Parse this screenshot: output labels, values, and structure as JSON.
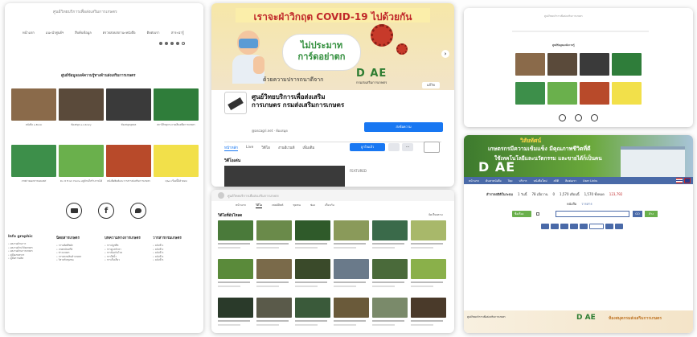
{
  "site": {
    "header_title": "ศูนย์วิทยบริการเพื่อส่งเสริมการเกษตร",
    "nav": [
      "หน้าแรก",
      "แนะนำศูนย์ฯ",
      "สืบค้นข้อมูล",
      "ตรวจสอบสถานะหนังสือ",
      "ติดต่อเรา",
      "สาระน่ารู้"
    ],
    "section_title": "ศูนย์ข้อมูลองค์ความรู้ทางด้านส่งเสริมการเกษตร",
    "tiles": [
      {
        "label": "หนังสือ e-Book",
        "color": "#8a6a4a"
      },
      {
        "label": "ห้องสมุด e-Library",
        "color": "#5a4a3a"
      },
      {
        "label": "ห้องสมุดบุคคล",
        "color": "#3a3a3a"
      },
      {
        "label": "สถานีวิทยุกระจายเสียงเพื่อการเกษตร",
        "color": "#2f7d3a"
      },
      {
        "label": "ภาพถ่ายเอกสารเผยแพร่",
        "color": "#3d8f4a"
      },
      {
        "label": "Do It From Home อยู่บ้านก็สร้างรายได้",
        "color": "#6ab04c"
      },
      {
        "label": "หนังสือพิมพ์และวารสารส่งเสริมการเกษตร",
        "color": "#b84a2a"
      },
      {
        "label": "Q&A เรื่องนี้มีคำตอบ",
        "color": "#f2e04a"
      }
    ],
    "footer_cols": [
      {
        "title": "Info graphic",
        "items": [
          "ผลงานด้านการ",
          "ผลงานด้านวิจัยเกษตร",
          "ผลงานด้านการเกษตร",
          "คู่มือเกษตรกร",
          "คู่มือการผลิต"
        ]
      },
      {
        "title": "นิตยสารเกษตร",
        "items": [
          "การผลิตพืชผัก",
          "เกษตรอินทรีย์",
          "ข่าวเกษตร",
          "การตลาดสินค้าเกษตร",
          "วิสาหกิจชุมชน"
        ]
      },
      {
        "title": "บทความทางการเกษตร",
        "items": [
          "การปลูกพืช",
          "การดูแลรักษา",
          "การป้องกันโรค",
          "การให้น้ำ",
          "การเก็บเกี่ยว"
        ]
      },
      {
        "title": "วารสารกรมเกษตร",
        "items": [
          "ฉบับที่ 1",
          "ฉบับที่ 2",
          "ฉบับที่ 3",
          "ฉบับที่ 4",
          "ฉบับที่ 5"
        ]
      }
    ]
  },
  "facebook": {
    "banner_text": "เราจะฝ่าวิกฤต COVID-19 ไปด้วยกัน",
    "bubble_line1": "ไม่ประมาท",
    "bubble_line2": "การ์ดอย่าตก",
    "caption": "ด้วยความปรารถนาดีจาก",
    "logo": "D  AE",
    "logo_sub": "กรมส่งเสริมการเกษตร",
    "page_name": "ศูนย์วิทยบริการเพื่อส่งเสริมการเกษตร กรมส่งเสริมการเกษตร",
    "handle": "@ascagri.net · ห้องสมุด",
    "like_button": "ถูกใจ",
    "message_button": "ส่งข้อความ",
    "tabs": [
      "หน้าหลัก",
      "Live",
      "วิดีโอ",
      "งานอีเวนท์",
      "เพิ่มเติม"
    ],
    "share_button": "ถูกใจแล้ว",
    "videos_heading": "วิดีโอเด่น",
    "featured_label": "FEATURED"
  },
  "youtube": {
    "channel_title": "ศูนย์วิทยบริการเพื่อส่งเสริมการเกษตร",
    "tabs": [
      "หน้าแรก",
      "วิดีโอ",
      "เพลย์ลิสต์",
      "ชุมชน",
      "ช่อง",
      "เกี่ยวกับ"
    ],
    "section": "วิดีโอที่อัปโหลด",
    "sort": "จัดเรียงตาม"
  },
  "catalog": {
    "header_title": "ศูนย์วิทยบริการเพื่อส่งเสริมการเกษตร",
    "section": "ศูนย์ข้อมูลองค์ความรู้"
  },
  "opac": {
    "banner_line1": "วิสัยทัศน์",
    "banner_line2": "เกษตรกรมีความเข้มแข็ง มีคุณภาพชีวิตที่ดี",
    "banner_line3": "ใช้เทคโนโลยีและนวัตกรรม และขายได้ก็เป็นคน",
    "logo": "D  AE",
    "menu": [
      "หน้าแรก",
      "ค้นหาหนังสือ",
      "Top",
      "บริการ",
      "หนังสือใหม่",
      "สถิติ",
      "ติดต่อเรา",
      "User Links"
    ],
    "stats_label": "สำรวจสถิติในระบบ",
    "stats": [
      "1 วันนี้",
      "78 เมื่อวาน",
      "0",
      "1,570 เดือนนี้",
      "1,570 ทั้งหมด",
      "123,792"
    ],
    "search_tabs": [
      "หนังสือ",
      "วารสาร"
    ],
    "search_select": "ชื่อเรื่อง",
    "search_button": "GO",
    "clear_button": "ล้าง",
    "promo_logo": "D  AE",
    "promo_text": "ห้องสมุดกรมส่งเสริมการเกษตร",
    "promo_sub": "ศูนย์วิทยบริการเพื่อส่งเสริมการเกษตร"
  },
  "colors": {
    "fb_blue": "#1877f2",
    "dark_green": "#1a5c2a",
    "logo_green": "#2e7d32",
    "opac_blue": "#4a6aa8",
    "opac_green": "#6ab04c",
    "banner_red": "#c0282a"
  }
}
